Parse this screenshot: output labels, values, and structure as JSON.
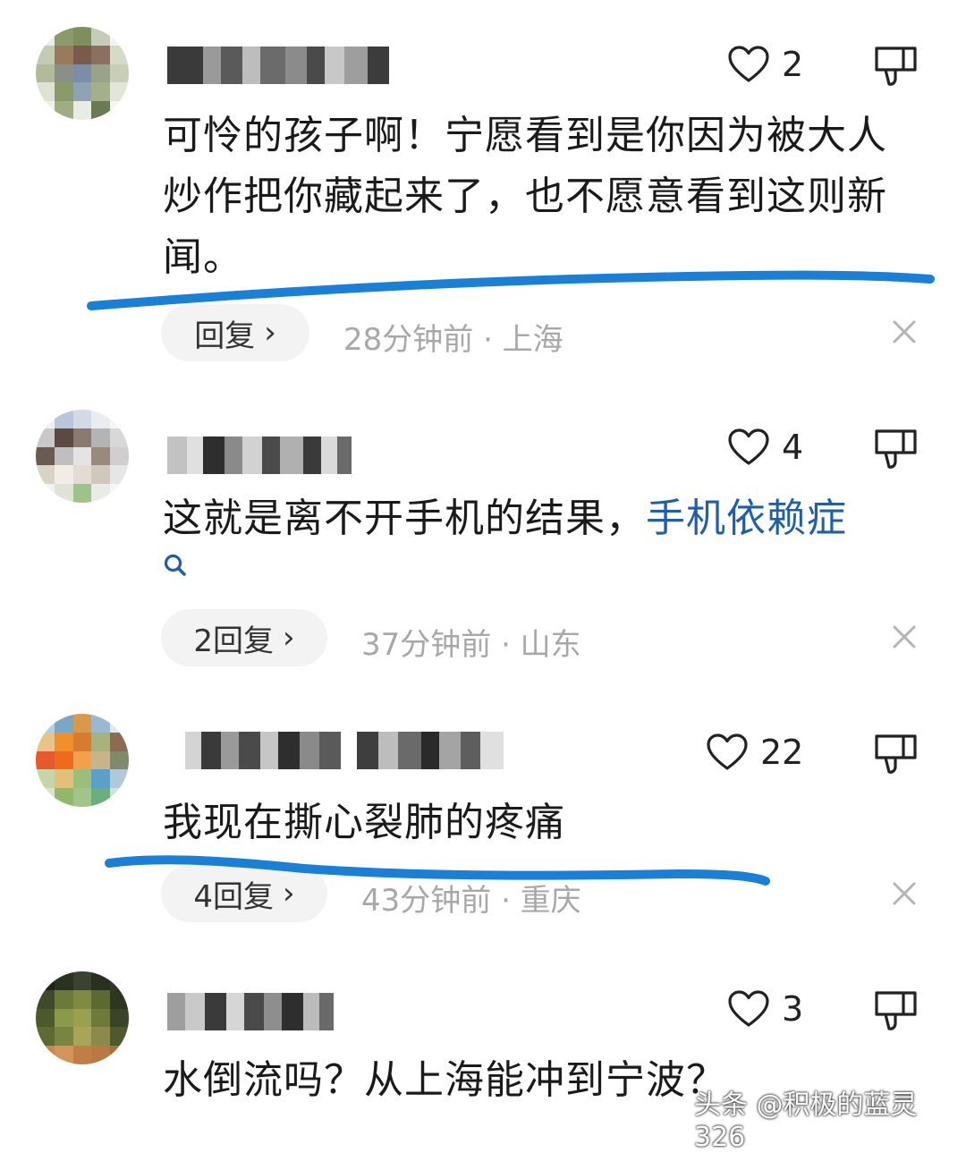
{
  "comments": [
    {
      "likes": "2",
      "text": "可怜的孩子啊！宁愿看到是你因为被大人炒作把你藏起来了，也不愿意看到这则新闻。",
      "reply_label": "回复",
      "meta": "28分钟前 · 上海"
    },
    {
      "likes": "4",
      "text": "这就是离不开手机的结果，",
      "topic": "手机依赖症",
      "reply_label": "2回复",
      "meta": "37分钟前 · 山东"
    },
    {
      "likes": "22",
      "text": "我现在撕心裂肺的疼痛",
      "reply_label": "4回复",
      "meta": "43分钟前 · 重庆"
    },
    {
      "likes": "3",
      "text": "水倒流吗？从上海能冲到宁波？"
    }
  ],
  "watermark": "头条 @积极的蓝灵326",
  "colors": {
    "topic": "#1f5fa8",
    "underline": "#1a7fd6",
    "meta": "#a8a8a8"
  }
}
